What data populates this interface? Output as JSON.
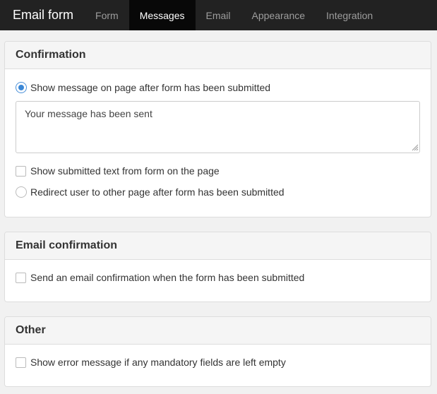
{
  "navbar": {
    "brand": "Email form",
    "tabs": [
      {
        "label": "Form",
        "active": false
      },
      {
        "label": "Messages",
        "active": true
      },
      {
        "label": "Email",
        "active": false
      },
      {
        "label": "Appearance",
        "active": false
      },
      {
        "label": "Integration",
        "active": false
      }
    ]
  },
  "confirmation": {
    "title": "Confirmation",
    "show_message_label": "Show message on page after form has been submitted",
    "show_message_selected": true,
    "message_value": "Your message has been sent",
    "show_submitted_label": "Show submitted text from form on the page",
    "show_submitted_checked": false,
    "redirect_label": "Redirect user to other page after form has been submitted",
    "redirect_selected": false
  },
  "email_confirmation": {
    "title": "Email confirmation",
    "send_label": "Send an email confirmation when the form has been submitted",
    "send_checked": false
  },
  "other": {
    "title": "Other",
    "error_label": "Show error message if any mandatory fields are left empty",
    "error_checked": false
  },
  "colors": {
    "navbar_bg": "#222222",
    "active_tab_bg": "#080808",
    "radio_accent": "#3a87d6"
  }
}
